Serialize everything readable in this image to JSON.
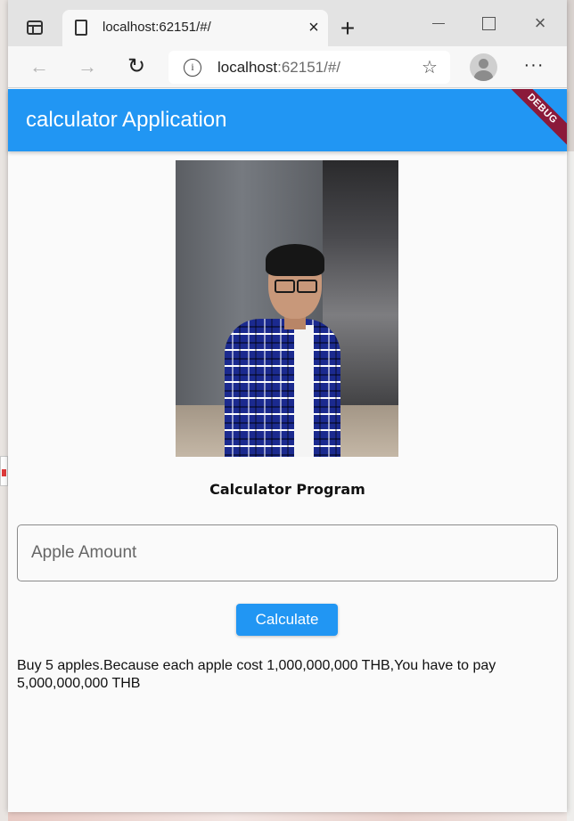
{
  "browser": {
    "tab_title": "localhost:62151/#/",
    "tab_close_glyph": "×",
    "new_tab_glyph": "+",
    "close_window_glyph": "×",
    "back_glyph": "←",
    "forward_glyph": "→",
    "reload_glyph": "↻",
    "info_glyph": "i",
    "favorite_glyph": "☆",
    "more_glyph": "···",
    "url_host": "localhost",
    "url_rest": ":62151/#/"
  },
  "app": {
    "title": "calculator Application",
    "debug_label": "DEBUG",
    "bar_color": "#2196f3"
  },
  "main": {
    "program_title": "Calculator Program",
    "apple_input_placeholder": "Apple Amount",
    "apple_input_value": "",
    "calculate_label": "Calculate",
    "result_text": "Buy 5 apples.Because each apple cost 1,000,000,000 THB,You have to pay 5,000,000,000 THB"
  },
  "icons": {
    "tab_actions": "tab-actions-icon",
    "page": "page-icon",
    "info": "info-icon",
    "favorite": "favorite-add-icon",
    "profile": "profile-icon",
    "more": "more-icon"
  }
}
